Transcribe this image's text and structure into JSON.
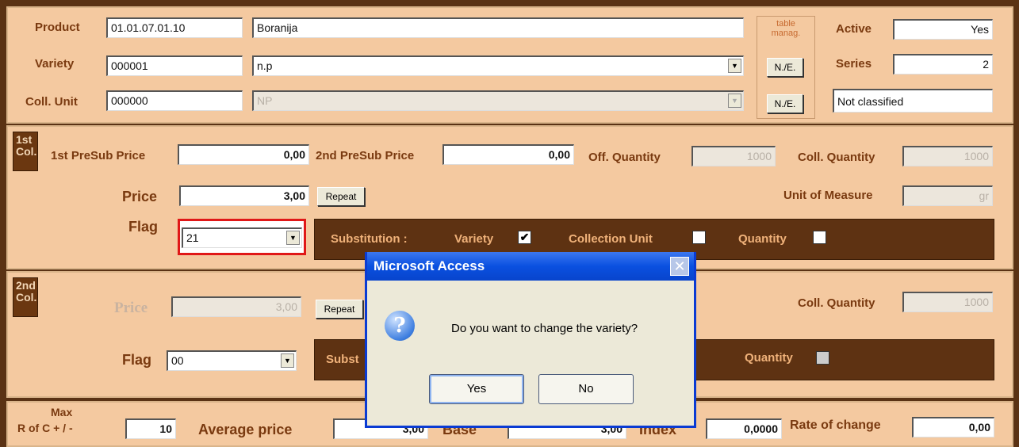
{
  "header": {
    "product_label": "Product",
    "product_code": "01.01.07.01.10",
    "product_name": "Boranija",
    "variety_label": "Variety",
    "variety_code": "000001",
    "variety_name": "n.p",
    "coll_unit_label": "Coll. Unit",
    "coll_unit_code": "000000",
    "coll_unit_name": "NP",
    "table_manag_label": "table manag.",
    "ne_button_1": "N./E.",
    "ne_button_2": "N./E.",
    "active_label": "Active",
    "active_value": "Yes",
    "series_label": "Series",
    "series_value": "2",
    "classification_value": "Not classified"
  },
  "col1": {
    "badge": "1st Col.",
    "presub1_label": "1st PreSub  Price",
    "presub1_value": "0,00",
    "presub2_label": "2nd PreSub Price",
    "presub2_value": "0,00",
    "off_qty_label": "Off. Quantity",
    "off_qty_value": "1000",
    "coll_qty_label": "Coll. Quantity",
    "coll_qty_value": "1000",
    "price_label": "Price",
    "price_value": "3,00",
    "repeat_label": "Repeat",
    "uom_label": "Unit of Measure",
    "uom_value": "gr",
    "flag_label": "Flag",
    "flag_value": "21",
    "substitution_label": "Substitution :",
    "variety_label": "Variety",
    "variety_checked": true,
    "coll_unit_label": "Collection Unit",
    "coll_unit_checked": false,
    "quantity_label": "Quantity",
    "quantity_checked": false
  },
  "col2": {
    "badge": "2nd Col.",
    "price_label": "Price",
    "price_value": "3,00",
    "repeat_label": "Repeat",
    "coll_qty_label": "Coll. Quantity",
    "coll_qty_value": "1000",
    "flag_label": "Flag",
    "flag_value": "00",
    "substitution_label_partial": "Subst",
    "quantity_label": "Quantity"
  },
  "footer": {
    "max_label_line1": "Max",
    "max_label_line2": "R of C + / -",
    "max_value": "10",
    "avg_price_label": "Average price",
    "avg_price_value": "3,00",
    "base_label": "Base",
    "base_value": "3,00",
    "index_label": "Index",
    "index_value": "0,0000",
    "rate_label": "Rate of change",
    "rate_value": "0,00"
  },
  "dialog": {
    "title": "Microsoft Access",
    "close_glyph": "✕",
    "message": "Do you want to change the variety?",
    "icon_glyph": "?",
    "yes_label": "Yes",
    "no_label": "No"
  },
  "glyphs": {
    "dropdown": "▼",
    "check": "✔"
  },
  "colors": {
    "panel": "#f4c9a0",
    "label": "#7a3a10",
    "frame": "#5a3214",
    "dialog_title": "#0a50e0"
  }
}
